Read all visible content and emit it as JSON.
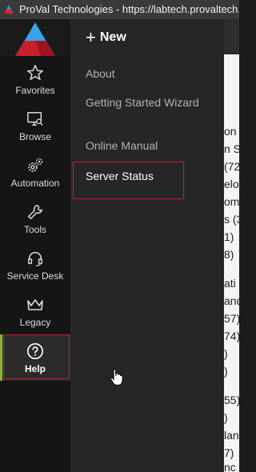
{
  "window": {
    "title": "ProVal Technologies - https://labtech.provaltech.com"
  },
  "sidebar": {
    "items": [
      {
        "label": "Favorites",
        "icon": "star-icon"
      },
      {
        "label": "Browse",
        "icon": "monitor-icon"
      },
      {
        "label": "Automation",
        "icon": "gears-icon"
      },
      {
        "label": "Tools",
        "icon": "wrench-icon"
      },
      {
        "label": "Service Desk",
        "icon": "headset-icon"
      },
      {
        "label": "Legacy",
        "icon": "crown-icon"
      },
      {
        "label": "Help",
        "icon": "question-circle-icon"
      }
    ]
  },
  "flyout": {
    "new_label": "New",
    "items": [
      {
        "label": "About"
      },
      {
        "label": "Getting Started Wizard"
      },
      {
        "label": "Online Manual"
      },
      {
        "label": "Server Status"
      }
    ]
  },
  "background_content": {
    "lines": [
      "on (",
      "n Sc",
      "(72",
      "elo",
      "omp",
      "s (3",
      "1)",
      "8)",
      "",
      "ati",
      "and",
      "57)",
      "74)",
      ")",
      ")",
      "",
      "55)",
      ")",
      "lan",
      "7)",
      "nc"
    ]
  },
  "colors": {
    "help_accent": "#8ab32a",
    "highlight_border": "#c8202a",
    "sidebar_bg": "#151515",
    "flyout_bg": "#262626"
  }
}
